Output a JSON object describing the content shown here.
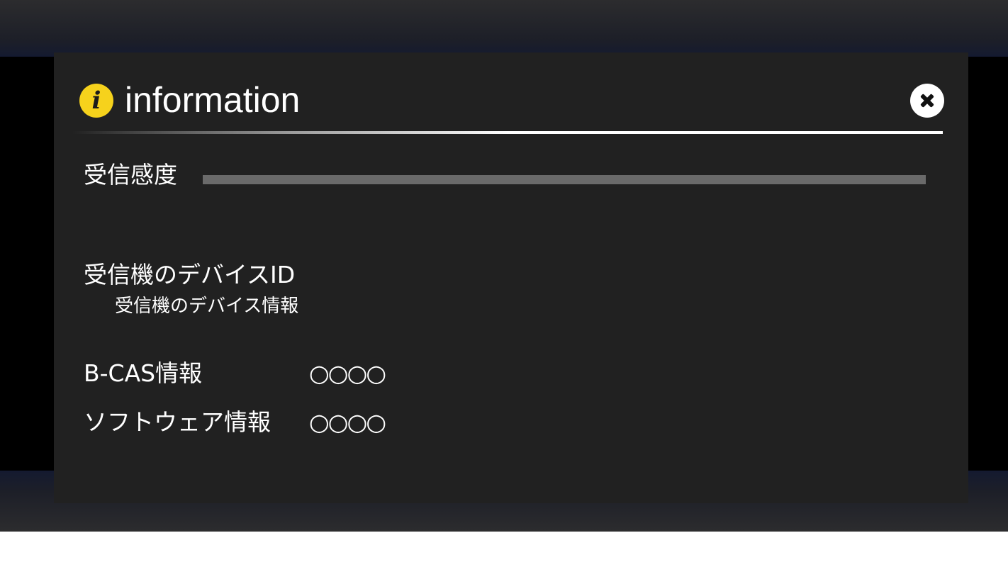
{
  "dialog": {
    "title": "information",
    "info_icon": "info-icon",
    "close_icon": "close-icon",
    "colors": {
      "panel": "#212121",
      "icon_accent": "#f6d21c",
      "text": "#ffffff"
    }
  },
  "signal": {
    "label": "受信感度",
    "level": 1.0
  },
  "device": {
    "label": "受信機のデバイスID",
    "value": "受信機のデバイス情報"
  },
  "bcas": {
    "label": "B-CAS情報",
    "value": "○○○○"
  },
  "software": {
    "label": "ソフトウェア情報",
    "value": "○○○○"
  }
}
